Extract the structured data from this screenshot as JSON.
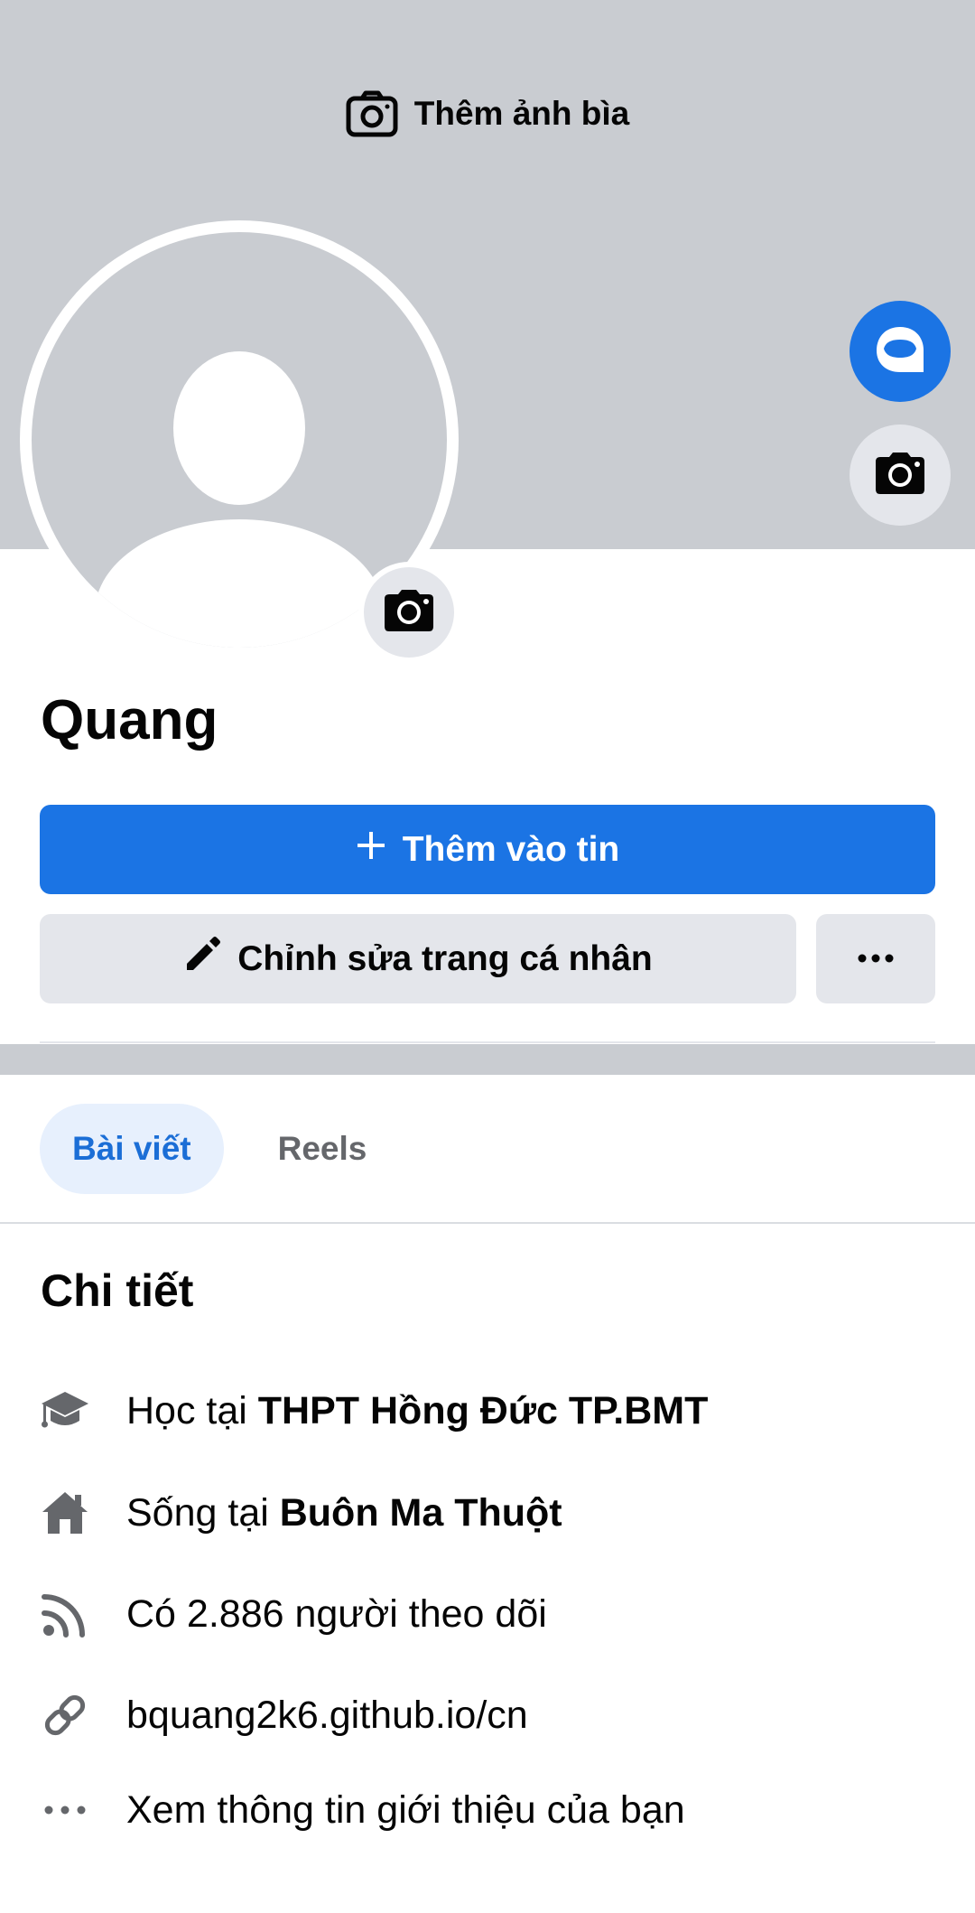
{
  "cover": {
    "add_cover_label": "Thêm ảnh bìa"
  },
  "profile": {
    "name": "Quang"
  },
  "actions": {
    "add_to_story": "Thêm vào tin",
    "edit_profile": "Chỉnh sửa trang cá nhân"
  },
  "tabs": [
    {
      "label": "Bài viết",
      "active": true
    },
    {
      "label": "Reels",
      "active": false
    }
  ],
  "details": {
    "title": "Chi tiết",
    "items": [
      {
        "icon": "graduation-cap-icon",
        "prefix": "Học tại ",
        "strong": "THPT Hồng Đức TP.BMT"
      },
      {
        "icon": "home-icon",
        "prefix": "Sống tại ",
        "strong": "Buôn Ma Thuột"
      },
      {
        "icon": "rss-icon",
        "prefix": "Có 2.886 người theo dõi",
        "strong": ""
      },
      {
        "icon": "link-icon",
        "prefix": "bquang2k6.github.io/cn",
        "strong": ""
      },
      {
        "icon": "more-dots-icon",
        "prefix": "Xem thông tin giới thiệu của bạn",
        "strong": ""
      }
    ]
  },
  "colors": {
    "brand_blue": "#1b74e4",
    "cover_gray": "#c9ccd1",
    "button_gray": "#e4e6eb"
  }
}
